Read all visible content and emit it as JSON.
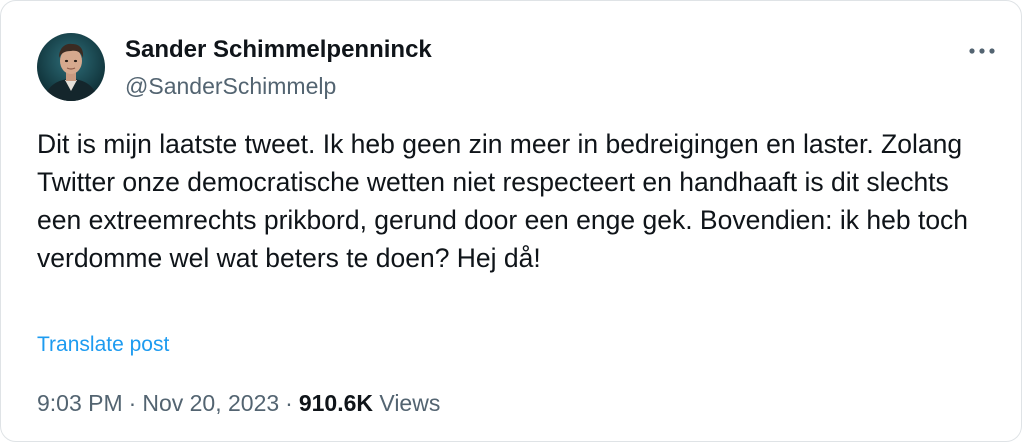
{
  "author": {
    "display_name": "Sander Schimmelpenninck",
    "handle": "@SanderSchimmelp"
  },
  "post": {
    "text": "Dit is mijn laatste tweet. Ik heb geen zin meer in bedreigingen en laster. Zolang Twitter onze democratische wetten niet respecteert en handhaaft is dit slechts een extreemrechts prikbord, gerund door een enge gek. Bovendien: ik heb toch verdomme wel wat beters te doen? Hej då!",
    "translate_label": "Translate post"
  },
  "meta": {
    "time": "9:03 PM",
    "date": "Nov 20, 2023",
    "separator": "·",
    "views_count": "910.6K",
    "views_label": "Views"
  },
  "icons": {
    "more": "more-options-icon",
    "avatar": "avatar-image"
  },
  "colors": {
    "text_primary": "#0f1419",
    "text_secondary": "#536471",
    "link": "#1d9bf0",
    "border": "#dfe3e6"
  }
}
